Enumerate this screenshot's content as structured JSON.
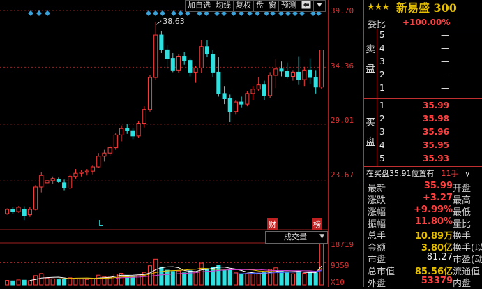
{
  "toolbar": {
    "buttons": [
      "加自选",
      "均线",
      "复权",
      "盘",
      "窗",
      "预测"
    ],
    "arrow_icon": "arrow-left-box-icon",
    "menu_icon": "dropdown-triangle-icon"
  },
  "price_axis": {
    "ticks": [
      "39.70",
      "34.36",
      "29.01",
      "23.67"
    ]
  },
  "volume_axis": {
    "ticks": [
      "18719",
      "9359",
      "X10"
    ]
  },
  "chart_annotations": {
    "high_label": "38.63",
    "l_marker": "L",
    "cai_marker": "财",
    "bang_marker": "榜"
  },
  "volume_indicator": {
    "selected": "成交量"
  },
  "chart_data": {
    "type": "candlestick",
    "price_range": [
      21.0,
      39.7
    ],
    "candles": [
      [
        20.6,
        21.1,
        20.5,
        21.0
      ],
      [
        21.0,
        21.2,
        20.6,
        20.8
      ],
      [
        20.8,
        21.3,
        20.7,
        21.2
      ],
      [
        21.0,
        21.3,
        20.0,
        20.4
      ],
      [
        20.5,
        21.2,
        20.3,
        21.0
      ],
      [
        21.0,
        23.3,
        20.9,
        23.1
      ],
      [
        23.1,
        24.5,
        22.6,
        24.2
      ],
      [
        23.5,
        24.2,
        22.9,
        23.7
      ],
      [
        23.7,
        24.1,
        23.4,
        23.9
      ],
      [
        23.8,
        24.0,
        23.5,
        23.6
      ],
      [
        23.5,
        23.8,
        22.8,
        23.0
      ],
      [
        23.0,
        24.3,
        22.9,
        24.1
      ],
      [
        24.1,
        24.8,
        23.9,
        24.4
      ],
      [
        24.4,
        24.7,
        24.1,
        24.5
      ],
      [
        24.5,
        24.8,
        24.2,
        24.6
      ],
      [
        24.6,
        25.2,
        24.3,
        25.0
      ],
      [
        25.0,
        26.3,
        24.9,
        26.0
      ],
      [
        26.0,
        26.6,
        25.5,
        26.3
      ],
      [
        26.3,
        27.0,
        26.0,
        26.8
      ],
      [
        26.8,
        28.2,
        26.6,
        28.0
      ],
      [
        28.0,
        28.9,
        27.4,
        28.6
      ],
      [
        28.6,
        29.0,
        28.1,
        28.4
      ],
      [
        28.4,
        28.6,
        27.6,
        27.9
      ],
      [
        27.9,
        29.3,
        27.7,
        29.1
      ],
      [
        29.1,
        30.7,
        28.7,
        30.4
      ],
      [
        30.4,
        33.6,
        30.2,
        33.4
      ],
      [
        33.4,
        38.6,
        33.2,
        37.4
      ],
      [
        37.4,
        37.8,
        35.7,
        36.0
      ],
      [
        36.0,
        36.4,
        34.2,
        35.2
      ],
      [
        35.2,
        35.7,
        33.9,
        34.1
      ],
      [
        34.1,
        35.6,
        33.8,
        35.4
      ],
      [
        35.4,
        35.8,
        34.6,
        35.0
      ],
      [
        35.0,
        35.2,
        33.5,
        33.9
      ],
      [
        33.9,
        34.5,
        32.9,
        34.3
      ],
      [
        34.3,
        36.9,
        33.8,
        36.3
      ],
      [
        36.3,
        36.9,
        35.3,
        35.6
      ],
      [
        35.6,
        36.0,
        33.4,
        33.9
      ],
      [
        33.9,
        35.3,
        31.6,
        31.9
      ],
      [
        31.9,
        32.6,
        30.9,
        31.4
      ],
      [
        31.4,
        31.8,
        29.2,
        30.2
      ],
      [
        30.2,
        31.3,
        29.9,
        31.1
      ],
      [
        31.1,
        31.6,
        30.6,
        30.9
      ],
      [
        30.9,
        32.1,
        30.7,
        31.9
      ],
      [
        31.9,
        32.6,
        31.3,
        32.3
      ],
      [
        32.3,
        33.4,
        32.1,
        32.7
      ],
      [
        32.7,
        33.1,
        31.3,
        31.7
      ],
      [
        31.7,
        33.9,
        31.5,
        33.6
      ],
      [
        33.6,
        35.1,
        32.4,
        34.2
      ],
      [
        34.2,
        34.9,
        33.5,
        34.0
      ],
      [
        34.0,
        34.8,
        33.3,
        33.5
      ],
      [
        33.5,
        34.1,
        33.1,
        33.9
      ],
      [
        33.9,
        35.4,
        32.7,
        33.2
      ],
      [
        33.2,
        34.4,
        32.6,
        34.1
      ],
      [
        34.1,
        35.2,
        32.8,
        33.4
      ],
      [
        33.4,
        34.1,
        31.9,
        32.5
      ],
      [
        32.5,
        35.99,
        32.3,
        35.99
      ]
    ],
    "volume_range": [
      0,
      18719
    ],
    "volumes": [
      1900,
      1700,
      2100,
      2000,
      1800,
      3900,
      4800,
      2900,
      2600,
      2200,
      2400,
      3000,
      2800,
      2500,
      2300,
      2700,
      4100,
      3500,
      3300,
      4600,
      4900,
      3900,
      3700,
      4200,
      5300,
      8100,
      10900,
      7600,
      6200,
      5700,
      5900,
      5100,
      6000,
      5600,
      9200,
      6900,
      7300,
      8300,
      6100,
      6600,
      5100,
      4400,
      4900,
      4600,
      5000,
      5200,
      6500,
      7200,
      5900,
      5300,
      4700,
      5800,
      4900,
      5300,
      5100,
      18719
    ]
  },
  "quote": {
    "stars": "★★★",
    "name": "新易盛 300",
    "weibi_label": "委比",
    "weibi_value": "+100.00%",
    "sell_label": "卖盘",
    "buy_label": "买盘",
    "sell_levels": [
      {
        "lvl": "5",
        "price": "—"
      },
      {
        "lvl": "4",
        "price": "—"
      },
      {
        "lvl": "3",
        "price": "—"
      },
      {
        "lvl": "2",
        "price": "—"
      },
      {
        "lvl": "1",
        "price": "—"
      }
    ],
    "buy_levels": [
      {
        "lvl": "1",
        "price": "35.99"
      },
      {
        "lvl": "2",
        "price": "35.98"
      },
      {
        "lvl": "3",
        "price": "35.96"
      },
      {
        "lvl": "4",
        "price": "35.95"
      },
      {
        "lvl": "5",
        "price": "35.93"
      }
    ],
    "position_text": "在买盘35.91位置有",
    "position_hands": "11手",
    "position_tail": "y",
    "stats": [
      {
        "k": "最新",
        "v": "35.99",
        "k2": "开盘"
      },
      {
        "k": "涨跌",
        "v": "+3.27",
        "k2": "最高"
      },
      {
        "k": "涨幅",
        "v": "+9.99%",
        "k2": "最低"
      },
      {
        "k": "振幅",
        "v": "11.80%",
        "k2": "量比"
      },
      {
        "k": "总手",
        "v": "10.89万",
        "k2": "换手"
      },
      {
        "k": "金额",
        "v": "3.80亿",
        "k2": "换手(以"
      },
      {
        "k": "市盘",
        "v": "81.27",
        "k2": "市盈(动"
      },
      {
        "k": "总市值",
        "v": "85.56亿",
        "k2": "流通值"
      },
      {
        "k": "外盘",
        "v": "53379",
        "k2": "内盘"
      }
    ]
  },
  "colors": {
    "up": "#ff3c3c",
    "down": "#2ee0e0",
    "grid": "#a02020",
    "ma5": "#ffffff",
    "ma10": "#e6c000",
    "ma20": "#d040d0",
    "ma60": "#4060ff"
  }
}
